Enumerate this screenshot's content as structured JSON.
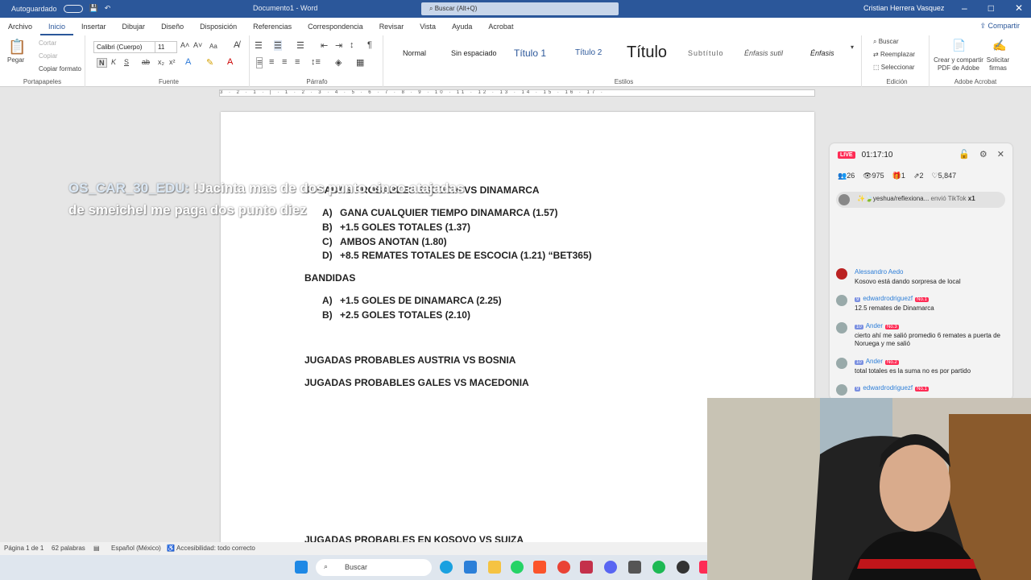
{
  "titlebar": {
    "autosave": "Autoguardado",
    "document": "Documento1 - Word",
    "search_placeholder": "Buscar (Alt+Q)",
    "user": "Cristian Herrera Vasquez"
  },
  "menu_tabs": [
    "Archivo",
    "Inicio",
    "Insertar",
    "Dibujar",
    "Diseño",
    "Disposición",
    "Referencias",
    "Correspondencia",
    "Revisar",
    "Vista",
    "Ayuda",
    "Acrobat"
  ],
  "share_label": "Compartir",
  "ribbon": {
    "clipboard": {
      "paste": "Pegar",
      "cut": "Cortar",
      "copy": "Copiar",
      "format_painter": "Copiar formato",
      "label": "Portapapeles"
    },
    "font": {
      "name": "Calibri (Cuerpo)",
      "size": "11",
      "label": "Fuente",
      "bold": "N",
      "italic": "K",
      "underline": "S",
      "case": "Aa"
    },
    "paragraph": {
      "label": "Párrafo"
    },
    "styles": {
      "items": [
        "Normal",
        "Sin espaciado",
        "Título 1",
        "Título 2",
        "Título",
        "Subtítulo",
        "Énfasis sutil",
        "Énfasis"
      ],
      "label": "Estilos"
    },
    "editing": {
      "find": "Buscar",
      "replace": "Reemplazar",
      "select": "Seleccionar",
      "label": "Edición"
    },
    "adobe": {
      "create": "Crear y compartir PDF de Adobe",
      "sign": "Solicitar firmas",
      "label": "Adobe Acrobat"
    }
  },
  "ruler_text": "3 · 2 · 1 · | · 1 · 2 · 3 · 4 · 5 · 6 · 7 · 8 · 9 · 10 · 11 · 12 · 13 · 14 · 15 · 16 · 17 ·",
  "document": {
    "heading1": "JUGADAS PROBABLES ESCOCIA VS DINAMARCA",
    "list1": [
      {
        "letter": "A)",
        "text": "GANA CUALQUIER TIEMPO DINAMARCA (1.57)"
      },
      {
        "letter": "B)",
        "text": "+1.5 GOLES TOTALES (1.37)"
      },
      {
        "letter": "C)",
        "text": "AMBOS ANOTAN (1.80)"
      },
      {
        "letter": "D)",
        "text": "+8.5 REMATES TOTALES DE ESCOCIA (1.21) “BET365)"
      }
    ],
    "bandidas": "BANDIDAS",
    "list2": [
      {
        "letter": "A)",
        "text": "+1.5 GOLES DE DINAMARCA (2.25)"
      },
      {
        "letter": "B)",
        "text": "+2.5 GOLES TOTALES (2.10)"
      }
    ],
    "heading2": "JUGADAS PROBABLES AUSTRIA VS BOSNIA",
    "heading3": "JUGADAS PROBABLES GALES VS MACEDONIA",
    "heading4": "JUGADAS PROBABLES EN KOSOVO VS SUIZA"
  },
  "status": {
    "page": "Página 1 de 1",
    "words": "62 palabras",
    "language": "Español (México)",
    "accessibility": "Accesibilidad: todo correcto"
  },
  "taskbar": {
    "search": "Buscar"
  },
  "caption": {
    "name": "OS_CAR_30_EDU:",
    "line1": "!Jacinta mas de dos punto cinco atajadas",
    "line2": "de smeichel me paga dos punto diez"
  },
  "live": {
    "badge": "LIVE",
    "timer": "01:17:10",
    "stats": {
      "members": "26",
      "viewers": "975",
      "gifts": "1",
      "shares": "2",
      "likes": "5,847"
    },
    "gift": {
      "user": "✨🍃yeshua/reflexiona...",
      "action": "envió TikTok",
      "count": "x1"
    },
    "comments": [
      {
        "user": "Alessandro Aedo",
        "level": "",
        "rank": "",
        "message": "Kosovo está dando sorpresa de local"
      },
      {
        "user": "edwardrodriguezf",
        "level": "9",
        "rank": "No.1",
        "message": "12.5 remates de Dinamarca"
      },
      {
        "user": "Ander",
        "level": "10",
        "rank": "No.3",
        "message": "cierto ahí me salió promedio 6 remates a puerta de Noruega y me salió"
      },
      {
        "user": "Ander",
        "level": "10",
        "rank": "No.2",
        "message": "total totales es la suma no es por partido"
      },
      {
        "user": "edwardrodriguezf",
        "level": "9",
        "rank": "No.1",
        "message": ""
      }
    ]
  },
  "colors": {
    "word_blue": "#2b579a",
    "tiktok_red": "#fe2c55"
  }
}
